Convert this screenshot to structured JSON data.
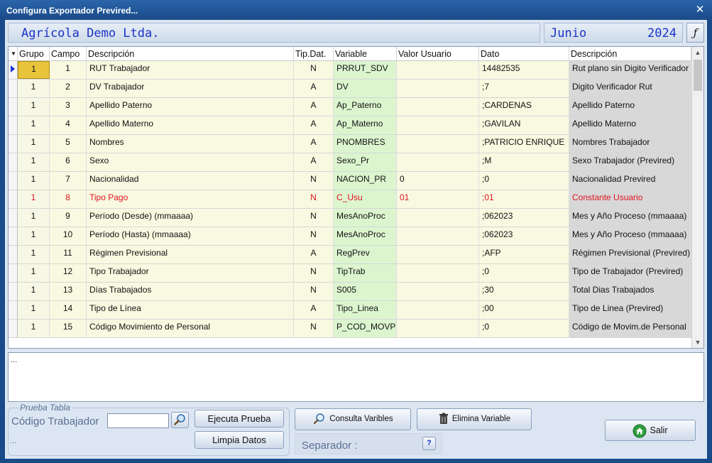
{
  "window": {
    "title": "Configura Exportador Previred..."
  },
  "header": {
    "company": "Agrícola Demo Ltda.",
    "month": "Junio",
    "year": "2024",
    "func_button": "ƒ"
  },
  "grid": {
    "columns": [
      "Grupo",
      "Campo",
      "Descripción",
      "Tip.Dat.",
      "Variable",
      "Valor Usuario",
      "Dato",
      "Descripción"
    ],
    "rows": [
      {
        "grupo": "1",
        "campo": "1",
        "desc": "RUT Trabajador",
        "tip": "N",
        "var": "PRRUT_SDV",
        "valor": "",
        "dato": "14482535",
        "desc2": "Rut plano sin Digito Verificador"
      },
      {
        "grupo": "1",
        "campo": "2",
        "desc": "DV Trabajador",
        "tip": "A",
        "var": "DV",
        "valor": "",
        "dato": ";7",
        "desc2": "Digito Verificador Rut"
      },
      {
        "grupo": "1",
        "campo": "3",
        "desc": "Apellido Paterno",
        "tip": "A",
        "var": "Ap_Paterno",
        "valor": "",
        "dato": ";CARDENAS",
        "desc2": "Apellido Paterno"
      },
      {
        "grupo": "1",
        "campo": "4",
        "desc": "Apellido Materno",
        "tip": "A",
        "var": "Ap_Materno",
        "valor": "",
        "dato": ";GAVILAN",
        "desc2": "Apellido Materno"
      },
      {
        "grupo": "1",
        "campo": "5",
        "desc": "Nombres",
        "tip": "A",
        "var": "PNOMBRES",
        "valor": "",
        "dato": ";PATRICIO ENRIQUE",
        "desc2": "Nombres Trabajador"
      },
      {
        "grupo": "1",
        "campo": "6",
        "desc": "Sexo",
        "tip": "A",
        "var": "Sexo_Pr",
        "valor": "",
        "dato": ";M",
        "desc2": "Sexo Trabajador (Previred)"
      },
      {
        "grupo": "1",
        "campo": "7",
        "desc": "Nacionalidad",
        "tip": "N",
        "var": "NACION_PR",
        "valor": "0",
        "dato": ";0",
        "desc2": "Nacionalidad Previred"
      },
      {
        "grupo": "1",
        "campo": "8",
        "desc": "Tipo Pago",
        "tip": "N",
        "var": "C_Usu",
        "valor": "01",
        "dato": ";01",
        "desc2": "Constante Usuario",
        "red": true
      },
      {
        "grupo": "1",
        "campo": "9",
        "desc": "Período (Desde) (mmaaaa)",
        "tip": "N",
        "var": "MesAnoProc",
        "valor": "",
        "dato": ";062023",
        "desc2": "Mes y Año Proceso (mmaaaa)"
      },
      {
        "grupo": "1",
        "campo": "10",
        "desc": "Período (Hasta) (mmaaaa)",
        "tip": "N",
        "var": "MesAnoProc",
        "valor": "",
        "dato": ";062023",
        "desc2": "Mes y Año Proceso (mmaaaa)"
      },
      {
        "grupo": "1",
        "campo": "11",
        "desc": "Régimen Previsional",
        "tip": "A",
        "var": "RegPrev",
        "valor": "",
        "dato": ";AFP",
        "desc2": "Régimen Previsional (Previred)"
      },
      {
        "grupo": "1",
        "campo": "12",
        "desc": "Tipo Trabajador",
        "tip": "N",
        "var": "TipTrab",
        "valor": "",
        "dato": ";0",
        "desc2": "Tipo de Trabajador (Previred)"
      },
      {
        "grupo": "1",
        "campo": "13",
        "desc": "Días Trabajados",
        "tip": "N",
        "var": "S005",
        "valor": "",
        "dato": ";30",
        "desc2": "Total Dias Trabajados"
      },
      {
        "grupo": "1",
        "campo": "14",
        "desc": "Tipo de Línea",
        "tip": "A",
        "var": "Tipo_Linea",
        "valor": "",
        "dato": ";00",
        "desc2": "Tipo de Linea (Previred)"
      },
      {
        "grupo": "1",
        "campo": "15",
        "desc": "Código Movimiento de Personal",
        "tip": "N",
        "var": "P_COD_MOVP",
        "valor": "",
        "dato": ";0",
        "desc2": "Código de Movim.de Personal"
      }
    ]
  },
  "memo": {
    "text": "..."
  },
  "prueba": {
    "title": "Prueba Tabla",
    "codigo_label": "Código Trabajador",
    "codigo_value": "",
    "footer_text": "...",
    "ejecuta_label": "Ejecuta Prueba",
    "limpia_label": "Limpia Datos"
  },
  "actions": {
    "consulta_label": "Consulta Varibles",
    "elimina_label": "Elimina Variable",
    "salir_label": "Salir",
    "separador_label": "Separador :",
    "help_label": "?"
  },
  "colors": {
    "title_bar": "#1a4a88",
    "accent_text": "#1a33c8",
    "highlight_red": "#e0141e",
    "active_cell": "#e8c43a"
  }
}
